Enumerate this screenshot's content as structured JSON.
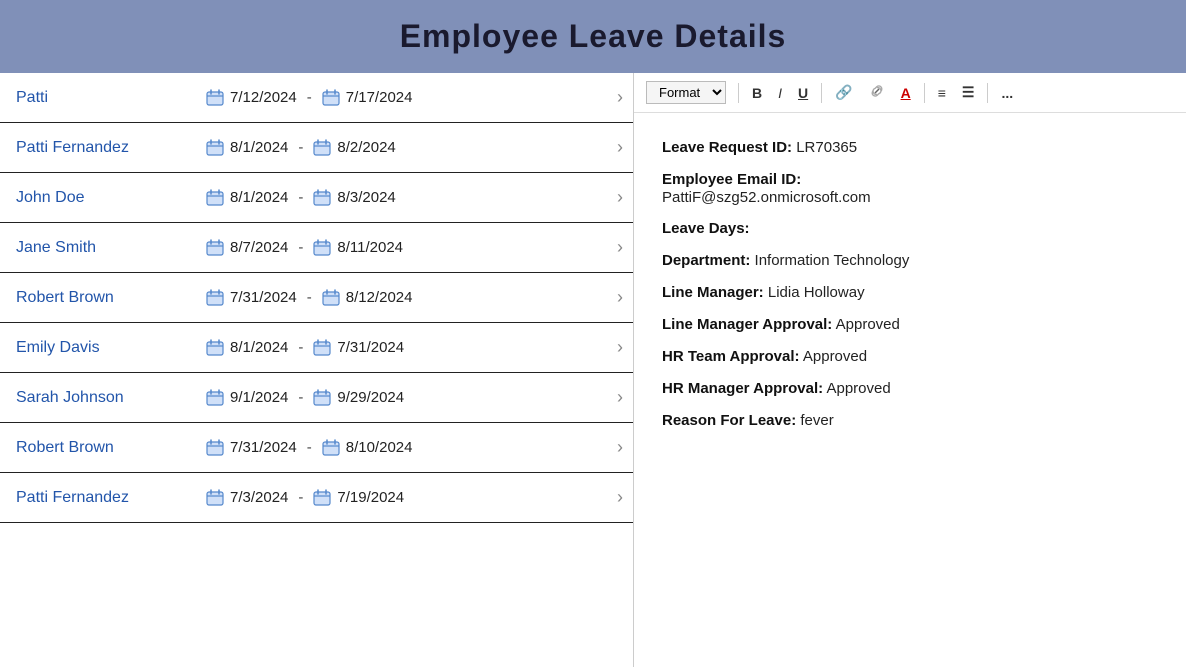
{
  "header": {
    "title": "Employee Leave Details"
  },
  "toolbar": {
    "format_label": "Format",
    "bold_label": "B",
    "italic_label": "I",
    "underline_label": "U",
    "link_label": "🔗",
    "unlink_label": "🔗",
    "highlight_label": "A",
    "list_label": "≡",
    "ordered_label": "☰",
    "more_label": "..."
  },
  "employees": [
    {
      "name": "Patti",
      "start": "7/12/2024",
      "end": "7/17/2024"
    },
    {
      "name": "Patti Fernandez",
      "start": "8/1/2024",
      "end": "8/2/2024"
    },
    {
      "name": "John Doe",
      "start": "8/1/2024",
      "end": "8/3/2024"
    },
    {
      "name": "Jane Smith",
      "start": "8/7/2024",
      "end": "8/11/2024"
    },
    {
      "name": "Robert Brown",
      "start": "7/31/2024",
      "end": "8/12/2024"
    },
    {
      "name": "Emily Davis",
      "start": "8/1/2024",
      "end": "7/31/2024"
    },
    {
      "name": "Sarah Johnson",
      "start": "9/1/2024",
      "end": "9/29/2024"
    },
    {
      "name": "Robert Brown",
      "start": "7/31/2024",
      "end": "8/10/2024"
    },
    {
      "name": "Patti Fernandez",
      "start": "7/3/2024",
      "end": "7/19/2024"
    }
  ],
  "detail": {
    "leave_request_id_label": "Leave Request ID:",
    "leave_request_id_value": "LR70365",
    "employee_email_label": "Employee Email ID:",
    "employee_email_value": "PattiF@szg52.onmicrosoft.com",
    "leave_days_label": "Leave Days:",
    "leave_days_value": "",
    "department_label": "Department:",
    "department_value": "Information Technology",
    "line_manager_label": "Line Manager:",
    "line_manager_value": "Lidia Holloway",
    "line_manager_approval_label": "Line Manager Approval:",
    "line_manager_approval_value": "Approved",
    "hr_team_approval_label": "HR Team Approval:",
    "hr_team_approval_value": "Approved",
    "hr_manager_approval_label": "HR Manager Approval:",
    "hr_manager_approval_value": "Approved",
    "reason_label": "Reason For Leave:",
    "reason_value": "fever"
  }
}
